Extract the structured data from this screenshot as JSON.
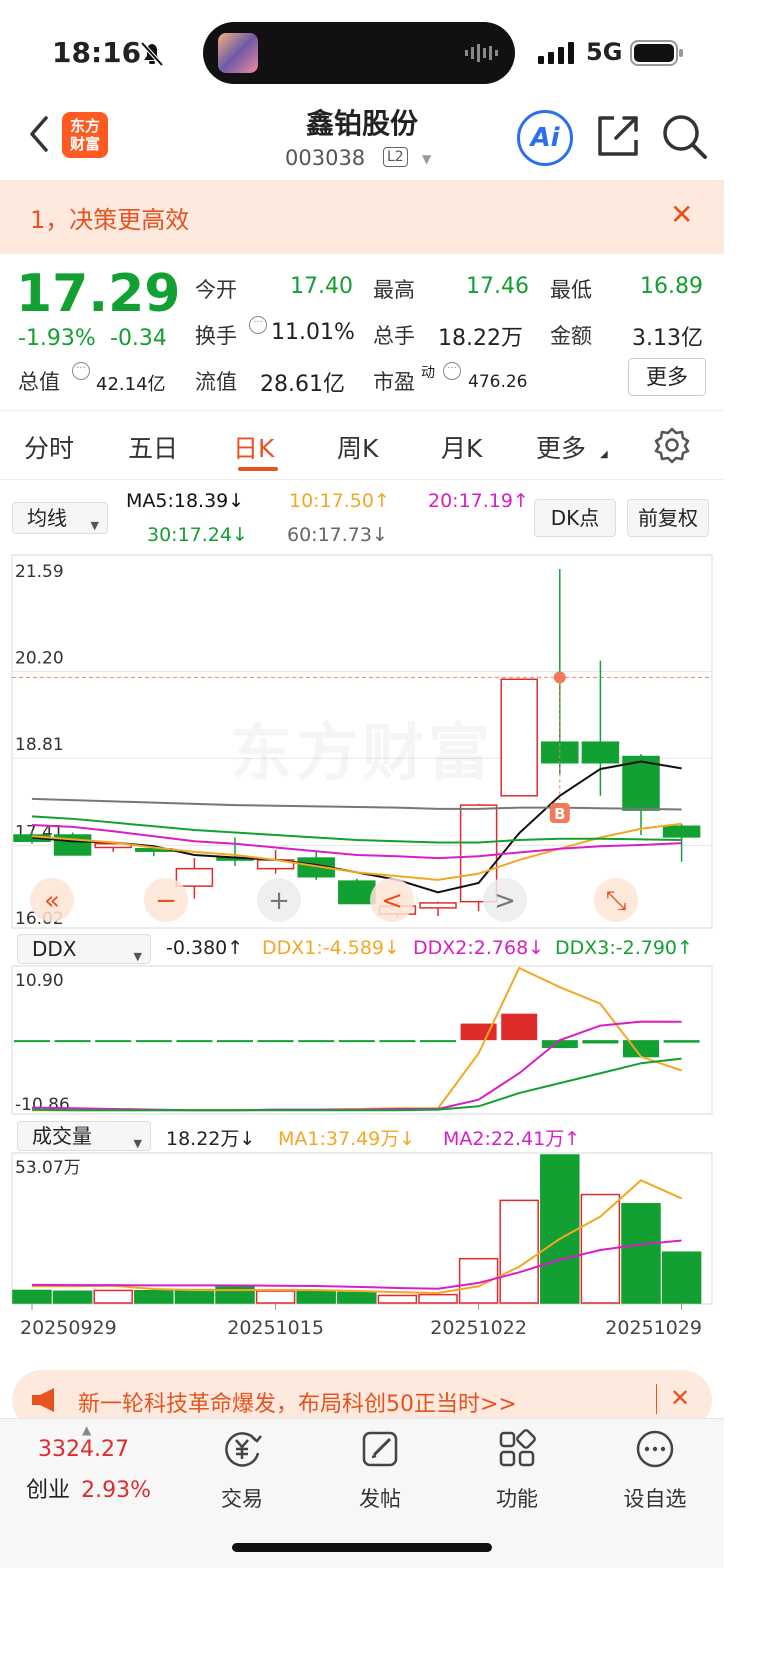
{
  "status": {
    "time": "18:16",
    "network": "5G"
  },
  "header": {
    "stock_name": "鑫铂股份",
    "stock_code": "003038",
    "level": "L2",
    "logo_line1": "东方",
    "logo_line2": "财富",
    "ai_label": "Ai"
  },
  "banner": {
    "text": "1，决策更高效"
  },
  "quote": {
    "price": "17.29",
    "change_pct": "-1.93%",
    "change_amt": "-0.34",
    "open_label": "今开",
    "open": "17.40",
    "high_label": "最高",
    "high": "17.46",
    "low_label": "最低",
    "low": "16.89",
    "turnover_label": "换手",
    "turnover": "11.01%",
    "volume_label": "总手",
    "volume": "18.22万",
    "amount_label": "金额",
    "amount": "3.13亿",
    "mcap_label": "总值",
    "mcap": "42.14亿",
    "float_label": "流值",
    "float_mcap": "28.61亿",
    "pe_label": "市盈",
    "pe_sup": "动",
    "pe": "476.26",
    "more": "更多"
  },
  "tabs": [
    "分时",
    "五日",
    "日K",
    "周K",
    "月K",
    "更多"
  ],
  "ma": {
    "selector": "均线",
    "ma5": "MA5:18.39↓",
    "ma10": "10:17.50↑",
    "ma20": "20:17.19↑",
    "ma30": "30:17.24↓",
    "ma60": "60:17.73↓",
    "dk_button": "DK点",
    "adjust_button": "前复权"
  },
  "watermark": "东方财富",
  "ddx": {
    "selector": "DDX",
    "value": "-0.380↑",
    "ddx1": "DDX1:-4.589↓",
    "ddx2": "DDX2:2.768↓",
    "ddx3": "DDX3:-2.790↑",
    "top": "10.90",
    "bottom": "-10.86"
  },
  "vol": {
    "selector": "成交量",
    "value": "18.22万↓",
    "ma1": "MA1:37.49万↓",
    "ma2": "MA2:22.41万↑",
    "top": "53.07万"
  },
  "dates": [
    "20250929",
    "20251015",
    "20251022",
    "20251029"
  ],
  "ad": {
    "text": "新一轮科技革命爆发，布局科创50正当时>>"
  },
  "nav": {
    "index_value": "3324.27",
    "index_name": "创业",
    "index_pct": "2.93%",
    "trade": "交易",
    "post": "发帖",
    "features": "功能",
    "watchlist": "设自选"
  },
  "colors": {
    "up": "#e02b2b",
    "down": "#13a032",
    "brand": "#e6531f",
    "ma5": "#111111",
    "ma10": "#f5a623",
    "ma20": "#d81ec8",
    "ma30": "#13a032",
    "ma60": "#777777"
  },
  "chart_data": [
    {
      "type": "candlestick",
      "title": "",
      "ylim": [
        16.02,
        21.59
      ],
      "y_ticks": [
        "21.59",
        "20.20",
        "18.81",
        "17.41",
        "16.02"
      ],
      "x_ticks": [
        "20250929",
        "20251015",
        "20251022",
        "20251029"
      ],
      "candles": [
        {
          "o": 17.32,
          "h": 17.38,
          "l": 17.18,
          "c": 17.22
        },
        {
          "o": 17.32,
          "h": 17.36,
          "l": 17.0,
          "c": 17.0
        },
        {
          "o": 17.12,
          "h": 17.18,
          "l": 17.05,
          "c": 17.18
        },
        {
          "o": 17.1,
          "h": 17.14,
          "l": 16.98,
          "c": 17.06
        },
        {
          "o": 16.5,
          "h": 16.95,
          "l": 16.3,
          "c": 16.78
        },
        {
          "o": 16.95,
          "h": 17.28,
          "l": 16.82,
          "c": 16.93
        },
        {
          "o": 16.78,
          "h": 17.08,
          "l": 16.7,
          "c": 16.92
        },
        {
          "o": 16.95,
          "h": 17.05,
          "l": 16.6,
          "c": 16.65
        },
        {
          "o": 16.58,
          "h": 16.62,
          "l": 16.22,
          "c": 16.22
        },
        {
          "o": 16.05,
          "h": 16.25,
          "l": 16.0,
          "c": 16.18
        },
        {
          "o": 16.15,
          "h": 16.25,
          "l": 16.02,
          "c": 16.23
        },
        {
          "o": 16.25,
          "h": 17.82,
          "l": 16.1,
          "c": 17.8
        },
        {
          "o": 17.95,
          "h": 19.82,
          "l": 17.95,
          "c": 19.82
        },
        {
          "o": 18.81,
          "h": 21.59,
          "l": 18.3,
          "c": 18.48
        },
        {
          "o": 18.81,
          "h": 20.12,
          "l": 17.95,
          "c": 18.48
        },
        {
          "o": 18.58,
          "h": 18.62,
          "l": 17.32,
          "c": 17.72
        },
        {
          "o": 17.46,
          "h": 17.5,
          "l": 16.89,
          "c": 17.29
        }
      ],
      "dashed_level": 19.85,
      "series": [
        {
          "name": "MA5",
          "values": [
            17.28,
            17.22,
            17.2,
            17.14,
            17.0,
            16.96,
            16.92,
            16.84,
            16.72,
            16.6,
            16.4,
            16.55,
            17.35,
            17.95,
            18.38,
            18.5,
            18.39
          ]
        },
        {
          "name": "MA10",
          "values": [
            17.3,
            17.25,
            17.2,
            17.12,
            17.05,
            17.0,
            16.92,
            16.82,
            16.72,
            16.66,
            16.6,
            16.7,
            16.92,
            17.1,
            17.28,
            17.42,
            17.5
          ]
        },
        {
          "name": "MA20",
          "values": [
            17.48,
            17.45,
            17.38,
            17.3,
            17.22,
            17.18,
            17.12,
            17.06,
            17.0,
            16.98,
            16.95,
            16.98,
            17.04,
            17.1,
            17.14,
            17.16,
            17.19
          ]
        },
        {
          "name": "MA30",
          "values": [
            17.62,
            17.58,
            17.52,
            17.46,
            17.4,
            17.36,
            17.32,
            17.28,
            17.24,
            17.22,
            17.2,
            17.2,
            17.24,
            17.26,
            17.26,
            17.25,
            17.24
          ]
        },
        {
          "name": "MA60",
          "values": [
            17.9,
            17.88,
            17.86,
            17.84,
            17.82,
            17.8,
            17.79,
            17.78,
            17.77,
            17.76,
            17.74,
            17.74,
            17.76,
            17.76,
            17.75,
            17.74,
            17.73
          ]
        }
      ]
    },
    {
      "type": "bar",
      "title": "DDX",
      "ylim": [
        -10.86,
        10.9
      ],
      "values": [
        -0.1,
        -0.2,
        -0.1,
        -0.1,
        -0.2,
        -0.1,
        -0.1,
        -0.1,
        -0.1,
        -0.1,
        -0.1,
        2.5,
        4.0,
        -1.2,
        -0.5,
        -2.6,
        -0.38
      ],
      "series": [
        {
          "name": "DDX1",
          "values": [
            -10.6,
            -10.6,
            -10.6,
            -10.6,
            -10.6,
            -10.6,
            -10.5,
            -10.5,
            -10.4,
            -10.3,
            -10.3,
            -2.0,
            10.9,
            8.0,
            5.5,
            -2.5,
            -4.59
          ]
        },
        {
          "name": "DDX2",
          "values": [
            -10.2,
            -10.3,
            -10.4,
            -10.5,
            -10.6,
            -10.6,
            -10.5,
            -10.5,
            -10.5,
            -10.4,
            -10.4,
            -9.0,
            -5.0,
            0.0,
            2.2,
            2.8,
            2.77
          ]
        },
        {
          "name": "DDX3",
          "values": [
            -10.5,
            -10.6,
            -10.6,
            -10.6,
            -10.6,
            -10.6,
            -10.6,
            -10.6,
            -10.6,
            -10.6,
            -10.5,
            -10.0,
            -8.0,
            -6.5,
            -5.0,
            -3.5,
            -2.79
          ]
        }
      ]
    },
    {
      "type": "bar",
      "title": "成交量",
      "ylim": [
        0,
        53.07
      ],
      "unit": "万",
      "values": [
        4.5,
        4.2,
        4.5,
        4.4,
        4.8,
        5.9,
        4.3,
        4.3,
        3.8,
        2.7,
        3.0,
        15.9,
        36.8,
        53.07,
        38.9,
        35.6,
        18.22
      ],
      "up": [
        false,
        false,
        true,
        false,
        false,
        false,
        true,
        false,
        false,
        true,
        true,
        true,
        true,
        false,
        true,
        false,
        false
      ],
      "series": [
        {
          "name": "MA1",
          "values": [
            6.0,
            6.0,
            6.2,
            5.0,
            4.6,
            4.6,
            4.7,
            4.6,
            4.3,
            3.9,
            3.6,
            6.0,
            13.0,
            23.0,
            31.0,
            44.0,
            37.49
          ]
        },
        {
          "name": "MA2",
          "values": [
            6.5,
            6.4,
            6.4,
            6.3,
            6.3,
            6.3,
            6.2,
            6.1,
            5.8,
            5.4,
            5.1,
            7.2,
            11.0,
            15.5,
            19.0,
            21.0,
            22.41
          ]
        }
      ]
    }
  ]
}
